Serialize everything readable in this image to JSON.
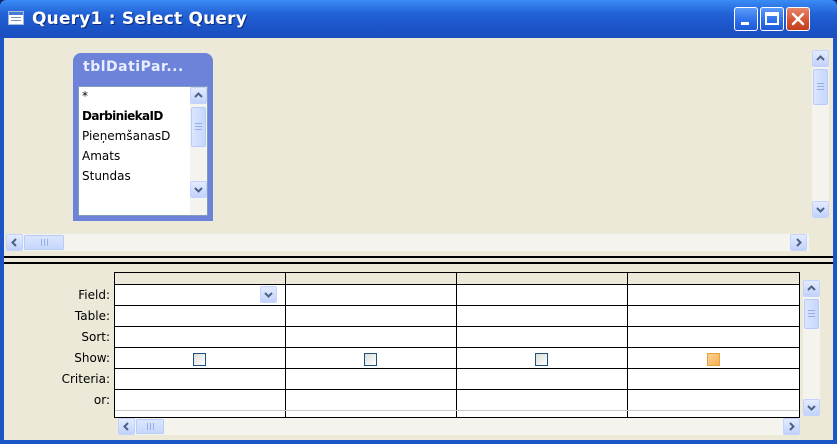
{
  "window": {
    "title": "Query1 : Select Query"
  },
  "table_box": {
    "name": "tblDatiPar...",
    "fields": [
      "*",
      "DarbiniekaID",
      "PieņemšanasD",
      "Amats",
      "Stundas"
    ]
  },
  "grid": {
    "row_labels": [
      "Field:",
      "Table:",
      "Sort:",
      "Show:",
      "Criteria:",
      "or:"
    ],
    "columns": [
      {
        "field": "",
        "table": "",
        "sort": "",
        "show": false,
        "criteria": "",
        "or": ""
      },
      {
        "field": "",
        "table": "",
        "sort": "",
        "show": false,
        "criteria": "",
        "or": ""
      },
      {
        "field": "",
        "table": "",
        "sort": "",
        "show": false,
        "criteria": "",
        "or": ""
      },
      {
        "field": "",
        "table": "",
        "sort": "",
        "show": false,
        "criteria": "",
        "or": ""
      }
    ]
  },
  "icons": {
    "window_icon": "query-window-icon",
    "minimize": "minimize-icon",
    "maximize": "maximize-icon",
    "close": "close-icon",
    "scroll_up": "chevron-up-icon",
    "scroll_down": "chevron-down-icon",
    "scroll_left": "chevron-left-icon",
    "scroll_right": "chevron-right-icon"
  },
  "colors": {
    "title_bar": "#2363d8",
    "table_header": "#6d83d9",
    "close_button": "#d5512e",
    "focused_checkbox": "#f6b04f"
  }
}
